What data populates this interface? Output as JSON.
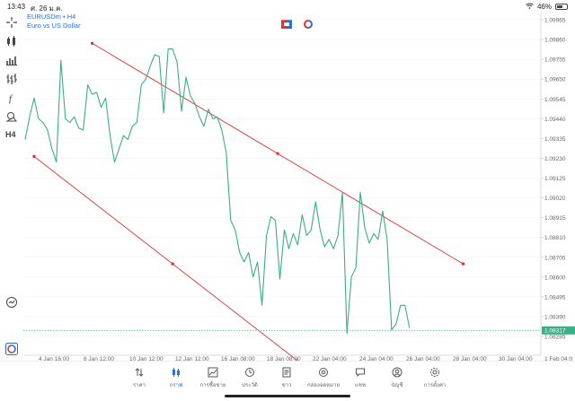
{
  "status_bar": {
    "time": "13:43",
    "date": "ศ. 26 ม.ค.",
    "battery": "46%",
    "battery_level": 0.46
  },
  "symbol": {
    "name": "EURUSDm • H4",
    "description": "Euro vs US Dollar"
  },
  "toolbar": {
    "timeframe_label": "H4"
  },
  "price_label": "1.08317",
  "colors": {
    "line": "#3aaf86",
    "channel": "#e0322f",
    "price_tag": "#3aaf86",
    "accent": "#2a6fd6"
  },
  "chart_data": {
    "type": "line",
    "y_ticks": [
      "1.09965",
      "1.09860",
      "1.09755",
      "1.09650",
      "1.09545",
      "1.09440",
      "1.09335",
      "1.09230",
      "1.09125",
      "1.09020",
      "1.08915",
      "1.08810",
      "1.08705",
      "1.08600",
      "1.08495",
      "1.08390",
      "1.08285"
    ],
    "x_ticks": [
      "4 Jan 16:00",
      "8 Jan 12:00",
      "10 Jan 12:00",
      "12 Jan 12:00",
      "16 Jan 08:00",
      "18 Jan 08:00",
      "22 Jan 04:00",
      "24 Jan 04:00",
      "26 Jan 04:00",
      "28 Jan 04:00",
      "30 Jan 04:00",
      "1 Feb 04:0"
    ],
    "ylim": [
      1.0823,
      1.1002
    ],
    "xlim": [
      0,
      115
    ],
    "current_price": 1.08317,
    "series": [
      {
        "values": [
          1.0933,
          1.0945,
          1.0955,
          1.0944,
          1.0942,
          1.0938,
          1.0928,
          1.0921,
          1.0975,
          1.0944,
          1.0942,
          1.0945,
          1.0939,
          1.0938,
          1.0962,
          1.0957,
          1.0958,
          1.095,
          1.0955,
          1.0935,
          1.0921,
          1.0928,
          1.0935,
          1.0933,
          1.094,
          1.0942,
          1.0962,
          1.0965,
          1.0972,
          1.0978,
          1.0977,
          1.0947,
          1.0981,
          1.0981,
          1.0974,
          1.0948,
          1.0966,
          1.0956,
          1.0952,
          1.0945,
          1.094,
          1.0949,
          1.0944,
          1.0945,
          1.0938,
          1.0926,
          1.089,
          1.0885,
          1.0873,
          1.0868,
          1.0873,
          1.086,
          1.0868,
          1.0845,
          1.0882,
          1.0892,
          1.089,
          1.0859,
          1.0885,
          1.0875,
          1.0883,
          1.0877,
          1.0893,
          1.0882,
          1.0885,
          1.09,
          1.0885,
          1.0876,
          1.088,
          1.0875,
          1.0882,
          1.0905,
          1.083,
          1.086,
          1.0865,
          1.0905,
          1.0886,
          1.0878,
          1.0883,
          1.088,
          1.0895,
          1.088,
          1.0832,
          1.0835,
          1.0845,
          1.0845,
          1.0833
        ]
      }
    ],
    "channel_lines": [
      {
        "x": [
          15,
          98
        ],
        "y": [
          1.0984,
          1.0867
        ]
      },
      {
        "x": [
          2,
          64
        ],
        "y": [
          1.0924,
          1.081
        ]
      }
    ]
  },
  "nav": [
    {
      "label": "ราคา",
      "icon": "arrows-updown-icon"
    },
    {
      "label": "กราฟ",
      "icon": "candles-icon",
      "active": true
    },
    {
      "label": "การซื้อขาย",
      "icon": "trend-icon"
    },
    {
      "label": "ประวัติ",
      "icon": "history-icon"
    },
    {
      "label": "ข่าว",
      "icon": "news-icon"
    },
    {
      "label": "กล่องจดหมาย",
      "icon": "at-icon"
    },
    {
      "label": "แชท",
      "icon": "chat-icon"
    },
    {
      "label": "บัญชี",
      "icon": "account-icon"
    },
    {
      "label": "การตั้งค่า",
      "icon": "gear-icon"
    }
  ]
}
